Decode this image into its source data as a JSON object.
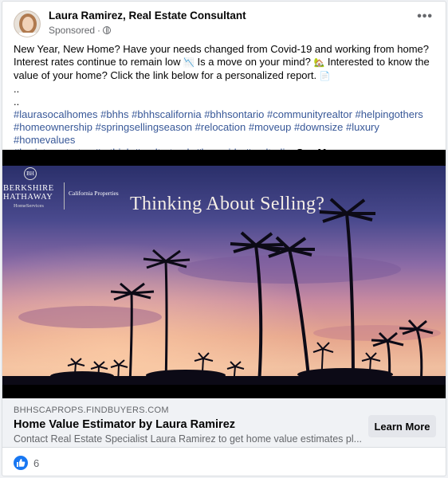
{
  "post": {
    "author": "Laura Ramirez, Real Estate Consultant",
    "sponsored": "Sponsored",
    "more_icon": "more-dots-icon",
    "privacy_icon": "globe-icon",
    "body_lines": [
      "New Year, New Home? Have your needs changed from Covid-19 and working from home?",
      "Interest rates continue to remain low",
      "Is a move on your mind?",
      "Interested to know the",
      "value of your home? Click the link below for a personalized report."
    ],
    "dots1": "..",
    "dots2": "..",
    "hashtag_line1": "#laurasocalhomes #bhhs #bhhscalifornia #bhhsontario #communityrealtor #helpingothers",
    "hashtag_line2": "#homeownership #springsellingseason #relocation #moveup #downsize #luxury #homevalues",
    "hashtag_line3": "#lowinterestrates #rethink #realtortorch #busyside #realtorli...",
    "see_more": "See More"
  },
  "image": {
    "headline": "Thinking About Selling?",
    "logo_line1": "BERKSHIRE",
    "logo_line2": "HATHAWAY",
    "logo_sub": "HomeServices",
    "logo_region": "California Properties",
    "logo_seal": "BH"
  },
  "ad": {
    "domain": "BHHSCAPROPS.FINDBUYERS.COM",
    "title": "Home Value Estimator by Laura Ramirez",
    "description": "Contact Real Estate Specialist Laura Ramirez to get home value estimates pl...",
    "cta": "Learn More"
  },
  "reactions": {
    "count": "6",
    "icon": "like-icon"
  },
  "colors": {
    "hashtag": "#385898",
    "like": "#1877f2"
  }
}
